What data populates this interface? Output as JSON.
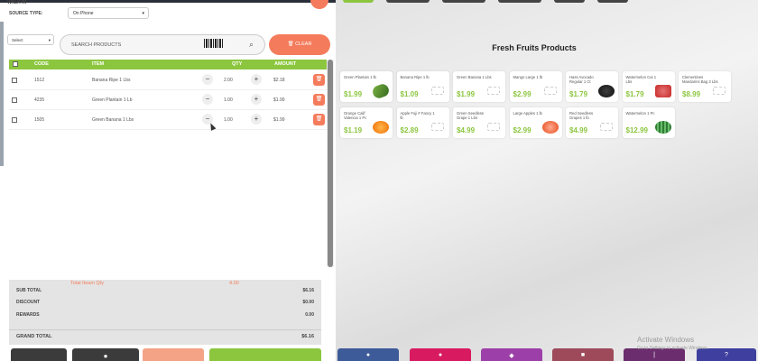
{
  "header": {
    "title": "WALK IN",
    "source_label": "SOURCE TYPE:",
    "source_value": "On Phone"
  },
  "search": {
    "filter_value": "Select",
    "placeholder": "SEARCH PRODUCTS",
    "clear_label": "CLEAR"
  },
  "table": {
    "columns": [
      "CODE",
      "ITEM",
      "QTY",
      "AMOUNT"
    ],
    "rows": [
      {
        "code": "1512",
        "item": "Banana Ripe 1 Lbs",
        "qty": "2.00",
        "amount": "$2.18"
      },
      {
        "code": "4235",
        "item": "Green Plantain 1 Lb",
        "qty": "1.00",
        "amount": "$1.99"
      },
      {
        "code": "1505",
        "item": "Green Banana 1 Lbs",
        "qty": "1.00",
        "amount": "$1.99"
      }
    ]
  },
  "summary": {
    "total_items_label": "Total Iteam Qty",
    "total_items_value": "4.00",
    "sub_total_label": "SUB TOTAL",
    "sub_total_value": "$6.16",
    "discount_label": "DISCOUNT",
    "discount_value": "$0.00",
    "rewards_label": "REWARDS",
    "rewards_value": "0.00",
    "grand_total_label": "GRAND TOTAL",
    "grand_total_value": "$6.16"
  },
  "catalog": {
    "title": "Fresh Fruits Products",
    "products": [
      {
        "name": "Green Plantain 1 lb",
        "price": "$1.99",
        "image": "plantain"
      },
      {
        "name": "Banana Ripe 1 lb",
        "price": "$1.09",
        "image": "placeholder"
      },
      {
        "name": "Green Banana 1 Lbs",
        "price": "$1.99",
        "image": "placeholder"
      },
      {
        "name": "Mango Large 1 lb",
        "price": "$2.99",
        "image": "placeholder"
      },
      {
        "name": "Hass Avocado Regular 1 Ct",
        "price": "$1.79",
        "image": "avocado"
      },
      {
        "name": "Watermelon Cut 1 Lbs",
        "price": "$1.79",
        "image": "watermelon-cut"
      },
      {
        "name": "Clementines Mandarins Bag 3 Lbs",
        "price": "$8.99",
        "image": "placeholder"
      },
      {
        "name": "Orange Calif Valencia 1 Pc",
        "price": "$1.19",
        "image": "orange"
      },
      {
        "name": "Apple Fuji # Fancy 1 lb",
        "price": "$2.89",
        "image": "placeholder"
      },
      {
        "name": "Green Seedless Grape 1 Lbs",
        "price": "$4.99",
        "image": "placeholder"
      },
      {
        "name": "Large Apples 1 lb",
        "price": "$2.99",
        "image": "peach"
      },
      {
        "name": "Red Seedless Grapes 1 lb",
        "price": "$4.99",
        "image": "placeholder"
      },
      {
        "name": "Watermelon 1 Pc",
        "price": "$12.99",
        "image": "watermelon"
      }
    ]
  },
  "watermark": {
    "line1": "Activate Windows",
    "line2": "Go to Settings to activate Windows."
  },
  "colors": {
    "accent_green": "#8cc63f",
    "accent_orange": "#f47c5c"
  }
}
